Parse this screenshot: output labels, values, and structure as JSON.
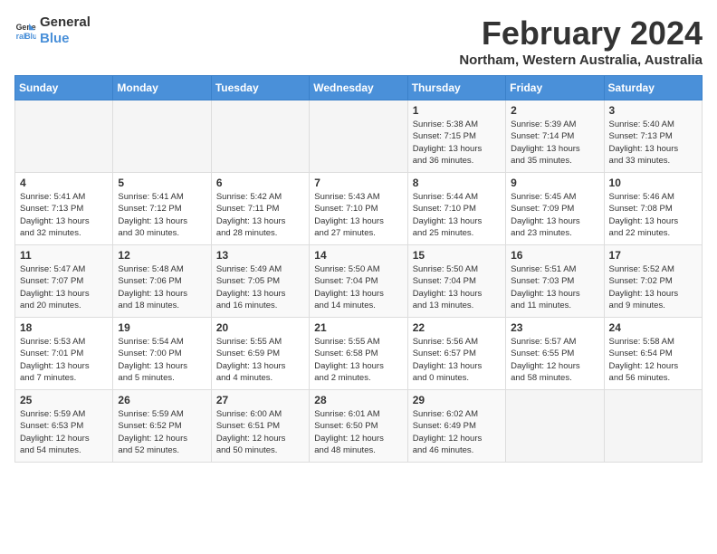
{
  "header": {
    "logo_line1": "General",
    "logo_line2": "Blue",
    "month": "February 2024",
    "location": "Northam, Western Australia, Australia"
  },
  "days_of_week": [
    "Sunday",
    "Monday",
    "Tuesday",
    "Wednesday",
    "Thursday",
    "Friday",
    "Saturday"
  ],
  "weeks": [
    [
      {
        "day": "",
        "info": ""
      },
      {
        "day": "",
        "info": ""
      },
      {
        "day": "",
        "info": ""
      },
      {
        "day": "",
        "info": ""
      },
      {
        "day": "1",
        "info": "Sunrise: 5:38 AM\nSunset: 7:15 PM\nDaylight: 13 hours\nand 36 minutes."
      },
      {
        "day": "2",
        "info": "Sunrise: 5:39 AM\nSunset: 7:14 PM\nDaylight: 13 hours\nand 35 minutes."
      },
      {
        "day": "3",
        "info": "Sunrise: 5:40 AM\nSunset: 7:13 PM\nDaylight: 13 hours\nand 33 minutes."
      }
    ],
    [
      {
        "day": "4",
        "info": "Sunrise: 5:41 AM\nSunset: 7:13 PM\nDaylight: 13 hours\nand 32 minutes."
      },
      {
        "day": "5",
        "info": "Sunrise: 5:41 AM\nSunset: 7:12 PM\nDaylight: 13 hours\nand 30 minutes."
      },
      {
        "day": "6",
        "info": "Sunrise: 5:42 AM\nSunset: 7:11 PM\nDaylight: 13 hours\nand 28 minutes."
      },
      {
        "day": "7",
        "info": "Sunrise: 5:43 AM\nSunset: 7:10 PM\nDaylight: 13 hours\nand 27 minutes."
      },
      {
        "day": "8",
        "info": "Sunrise: 5:44 AM\nSunset: 7:10 PM\nDaylight: 13 hours\nand 25 minutes."
      },
      {
        "day": "9",
        "info": "Sunrise: 5:45 AM\nSunset: 7:09 PM\nDaylight: 13 hours\nand 23 minutes."
      },
      {
        "day": "10",
        "info": "Sunrise: 5:46 AM\nSunset: 7:08 PM\nDaylight: 13 hours\nand 22 minutes."
      }
    ],
    [
      {
        "day": "11",
        "info": "Sunrise: 5:47 AM\nSunset: 7:07 PM\nDaylight: 13 hours\nand 20 minutes."
      },
      {
        "day": "12",
        "info": "Sunrise: 5:48 AM\nSunset: 7:06 PM\nDaylight: 13 hours\nand 18 minutes."
      },
      {
        "day": "13",
        "info": "Sunrise: 5:49 AM\nSunset: 7:05 PM\nDaylight: 13 hours\nand 16 minutes."
      },
      {
        "day": "14",
        "info": "Sunrise: 5:50 AM\nSunset: 7:04 PM\nDaylight: 13 hours\nand 14 minutes."
      },
      {
        "day": "15",
        "info": "Sunrise: 5:50 AM\nSunset: 7:04 PM\nDaylight: 13 hours\nand 13 minutes."
      },
      {
        "day": "16",
        "info": "Sunrise: 5:51 AM\nSunset: 7:03 PM\nDaylight: 13 hours\nand 11 minutes."
      },
      {
        "day": "17",
        "info": "Sunrise: 5:52 AM\nSunset: 7:02 PM\nDaylight: 13 hours\nand 9 minutes."
      }
    ],
    [
      {
        "day": "18",
        "info": "Sunrise: 5:53 AM\nSunset: 7:01 PM\nDaylight: 13 hours\nand 7 minutes."
      },
      {
        "day": "19",
        "info": "Sunrise: 5:54 AM\nSunset: 7:00 PM\nDaylight: 13 hours\nand 5 minutes."
      },
      {
        "day": "20",
        "info": "Sunrise: 5:55 AM\nSunset: 6:59 PM\nDaylight: 13 hours\nand 4 minutes."
      },
      {
        "day": "21",
        "info": "Sunrise: 5:55 AM\nSunset: 6:58 PM\nDaylight: 13 hours\nand 2 minutes."
      },
      {
        "day": "22",
        "info": "Sunrise: 5:56 AM\nSunset: 6:57 PM\nDaylight: 13 hours\nand 0 minutes."
      },
      {
        "day": "23",
        "info": "Sunrise: 5:57 AM\nSunset: 6:55 PM\nDaylight: 12 hours\nand 58 minutes."
      },
      {
        "day": "24",
        "info": "Sunrise: 5:58 AM\nSunset: 6:54 PM\nDaylight: 12 hours\nand 56 minutes."
      }
    ],
    [
      {
        "day": "25",
        "info": "Sunrise: 5:59 AM\nSunset: 6:53 PM\nDaylight: 12 hours\nand 54 minutes."
      },
      {
        "day": "26",
        "info": "Sunrise: 5:59 AM\nSunset: 6:52 PM\nDaylight: 12 hours\nand 52 minutes."
      },
      {
        "day": "27",
        "info": "Sunrise: 6:00 AM\nSunset: 6:51 PM\nDaylight: 12 hours\nand 50 minutes."
      },
      {
        "day": "28",
        "info": "Sunrise: 6:01 AM\nSunset: 6:50 PM\nDaylight: 12 hours\nand 48 minutes."
      },
      {
        "day": "29",
        "info": "Sunrise: 6:02 AM\nSunset: 6:49 PM\nDaylight: 12 hours\nand 46 minutes."
      },
      {
        "day": "",
        "info": ""
      },
      {
        "day": "",
        "info": ""
      }
    ]
  ]
}
